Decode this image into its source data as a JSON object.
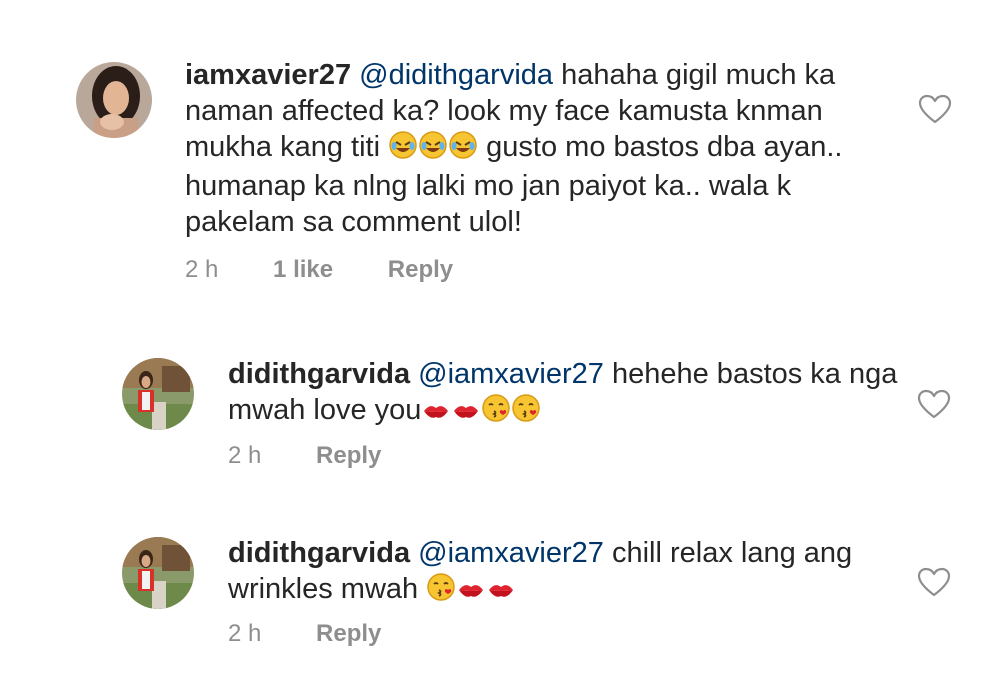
{
  "comments": [
    {
      "username": "iamxavier27",
      "mention": "@didithgarvida",
      "lines": [
        "hahaha gigil much ka",
        "naman affected ka? look my face kamusta knman",
        "mukha kang titi",
        "gusto mo bastos dba ayan..",
        "humanap ka nlng lalki mo jan paiyot ka.. wala k",
        "pakelam sa comment ulol!"
      ],
      "emojis": [
        "rofl-emoji",
        "rofl-emoji",
        "rofl-emoji"
      ],
      "time": "2 h",
      "likes": "1 like",
      "reply": "Reply"
    },
    {
      "username": "didithgarvida",
      "mention": "@iamxavier27",
      "lines": [
        "hehehe bastos ka nga",
        "mwah love you"
      ],
      "emojis": [
        "kiss-mark-emoji",
        "kiss-mark-emoji",
        "kissing-face-emoji",
        "kissing-face-emoji"
      ],
      "time": "2 h",
      "reply": "Reply"
    },
    {
      "username": "didithgarvida",
      "mention": "@iamxavier27",
      "lines": [
        "chill relax lang ang",
        "wrinkles mwah"
      ],
      "emojis": [
        "kissing-face-emoji",
        "kiss-mark-emoji",
        "kiss-mark-emoji"
      ],
      "time": "2 h",
      "reply": "Reply"
    }
  ],
  "colors": {
    "text": "#262626",
    "mention": "#003569",
    "meta": "#8e8e8e",
    "heart_outline": "#8e8e8e"
  }
}
